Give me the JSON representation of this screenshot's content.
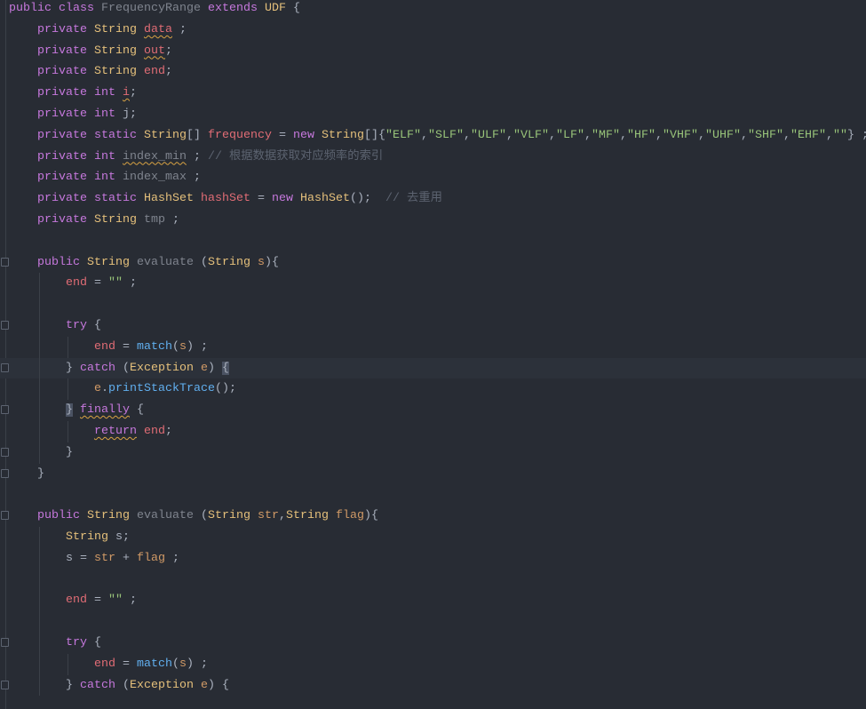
{
  "editor": {
    "colors": {
      "background": "#282c34",
      "keyword": "#c678dd",
      "type": "#e5c07b",
      "field": "#e06c75",
      "function": "#61afef",
      "param": "#d19a66",
      "string": "#98c379",
      "comment": "#5c6370"
    },
    "current_line": 18,
    "lines": [
      {
        "indent": 0,
        "fold": false,
        "tokens": [
          [
            "kw",
            "public class "
          ],
          [
            "nm",
            "FrequencyRange "
          ],
          [
            "kw",
            "extends "
          ],
          [
            "ty",
            "UDF "
          ],
          [
            "pl",
            "{"
          ]
        ]
      },
      {
        "indent": 1,
        "tokens": [
          [
            "kw",
            "private "
          ],
          [
            "ty",
            "String "
          ],
          [
            "fd warn",
            "data"
          ],
          [
            "pl",
            " ;"
          ]
        ]
      },
      {
        "indent": 1,
        "tokens": [
          [
            "kw",
            "private "
          ],
          [
            "ty",
            "String "
          ],
          [
            "fd warn",
            "out"
          ],
          [
            "pl",
            ";"
          ]
        ]
      },
      {
        "indent": 1,
        "tokens": [
          [
            "kw",
            "private "
          ],
          [
            "ty",
            "String "
          ],
          [
            "fd",
            "end"
          ],
          [
            "pl",
            ";"
          ]
        ]
      },
      {
        "indent": 1,
        "tokens": [
          [
            "kw",
            "private int "
          ],
          [
            "fd warn",
            "i"
          ],
          [
            "pl",
            ";"
          ]
        ]
      },
      {
        "indent": 1,
        "tokens": [
          [
            "kw",
            "private int "
          ],
          [
            "pl",
            "j;"
          ]
        ]
      },
      {
        "indent": 1,
        "tokens": [
          [
            "kw",
            "private static "
          ],
          [
            "ty",
            "String"
          ],
          [
            "pl",
            "[] "
          ],
          [
            "fd",
            "frequency"
          ],
          [
            "pl",
            " = "
          ],
          [
            "kw",
            "new "
          ],
          [
            "ty",
            "String"
          ],
          [
            "pl",
            "[]{"
          ],
          [
            "st",
            "\"ELF\""
          ],
          [
            "pl",
            ","
          ],
          [
            "st",
            "\"SLF\""
          ],
          [
            "pl",
            ","
          ],
          [
            "st",
            "\"ULF\""
          ],
          [
            "pl",
            ","
          ],
          [
            "st",
            "\"VLF\""
          ],
          [
            "pl",
            ","
          ],
          [
            "st",
            "\"LF\""
          ],
          [
            "pl",
            ","
          ],
          [
            "st",
            "\"MF\""
          ],
          [
            "pl",
            ","
          ],
          [
            "st",
            "\"HF\""
          ],
          [
            "pl",
            ","
          ],
          [
            "st",
            "\"VHF\""
          ],
          [
            "pl",
            ","
          ],
          [
            "st",
            "\"UHF\""
          ],
          [
            "pl",
            ","
          ],
          [
            "st",
            "\"SHF\""
          ],
          [
            "pl",
            ","
          ],
          [
            "st",
            "\"EHF\""
          ],
          [
            "pl",
            ","
          ],
          [
            "st",
            "\"\""
          ],
          [
            "pl",
            "} ;"
          ]
        ]
      },
      {
        "indent": 1,
        "tokens": [
          [
            "kw",
            "private int "
          ],
          [
            "nm warn",
            "index_min"
          ],
          [
            "pl",
            " ; "
          ],
          [
            "cm",
            "// 根据数据获取对应频率的索引"
          ]
        ]
      },
      {
        "indent": 1,
        "tokens": [
          [
            "kw",
            "private int "
          ],
          [
            "nm",
            "index_max"
          ],
          [
            "pl",
            " ;"
          ]
        ]
      },
      {
        "indent": 1,
        "tokens": [
          [
            "kw",
            "private static "
          ],
          [
            "ty",
            "HashSet "
          ],
          [
            "fd",
            "hashSet"
          ],
          [
            "pl",
            " = "
          ],
          [
            "kw",
            "new "
          ],
          [
            "ty",
            "HashSet"
          ],
          [
            "pl",
            "();  "
          ],
          [
            "cm",
            "// 去重用"
          ]
        ]
      },
      {
        "indent": 1,
        "tokens": [
          [
            "kw",
            "private "
          ],
          [
            "ty",
            "String "
          ],
          [
            "nm",
            "tmp"
          ],
          [
            "pl",
            " ;"
          ]
        ]
      },
      {
        "indent": 0,
        "tokens": []
      },
      {
        "indent": 1,
        "fold": true,
        "tokens": [
          [
            "kw",
            "public "
          ],
          [
            "ty",
            "String "
          ],
          [
            "nm",
            "evaluate "
          ],
          [
            "pl",
            "("
          ],
          [
            "ty",
            "String "
          ],
          [
            "pa",
            "s"
          ],
          [
            "pl",
            "){"
          ]
        ]
      },
      {
        "indent": 2,
        "tokens": [
          [
            "fd",
            "end"
          ],
          [
            "pl",
            " = "
          ],
          [
            "st",
            "\"\""
          ],
          [
            "pl",
            " ;"
          ]
        ]
      },
      {
        "indent": 2,
        "tokens": []
      },
      {
        "indent": 2,
        "fold": true,
        "tokens": [
          [
            "kw",
            "try "
          ],
          [
            "pl",
            "{"
          ]
        ]
      },
      {
        "indent": 3,
        "tokens": [
          [
            "fd",
            "end"
          ],
          [
            "pl",
            " = "
          ],
          [
            "fn",
            "match"
          ],
          [
            "pl",
            "("
          ],
          [
            "pa",
            "s"
          ],
          [
            "pl",
            ") ;"
          ]
        ]
      },
      {
        "indent": 2,
        "fold": true,
        "tokens": [
          [
            "pl",
            "} "
          ],
          [
            "kw",
            "catch "
          ],
          [
            "pl",
            "("
          ],
          [
            "ty",
            "Exception "
          ],
          [
            "pa",
            "e"
          ],
          [
            "pl",
            ") "
          ],
          [
            "pl brace",
            "{"
          ]
        ]
      },
      {
        "indent": 3,
        "tokens": [
          [
            "pa",
            "e"
          ],
          [
            "pl",
            "."
          ],
          [
            "fn",
            "printStackTrace"
          ],
          [
            "pl",
            "();"
          ]
        ]
      },
      {
        "indent": 2,
        "fold": true,
        "tokens": [
          [
            "pl brace",
            "}"
          ],
          [
            "pl",
            " "
          ],
          [
            "kw warn",
            "finally"
          ],
          [
            "pl",
            " {"
          ]
        ]
      },
      {
        "indent": 3,
        "tokens": [
          [
            "kw warn",
            "return"
          ],
          [
            "pl",
            " "
          ],
          [
            "fd",
            "end"
          ],
          [
            "pl",
            ";"
          ]
        ]
      },
      {
        "indent": 2,
        "fold": true,
        "tokens": [
          [
            "pl",
            "}"
          ]
        ]
      },
      {
        "indent": 1,
        "fold": true,
        "tokens": [
          [
            "pl",
            "}"
          ]
        ]
      },
      {
        "indent": 0,
        "tokens": []
      },
      {
        "indent": 1,
        "fold": true,
        "tokens": [
          [
            "kw",
            "public "
          ],
          [
            "ty",
            "String "
          ],
          [
            "nm",
            "evaluate "
          ],
          [
            "pl",
            "("
          ],
          [
            "ty",
            "String "
          ],
          [
            "pa",
            "str"
          ],
          [
            "pl",
            ","
          ],
          [
            "ty",
            "String "
          ],
          [
            "pa",
            "flag"
          ],
          [
            "pl",
            "){"
          ]
        ]
      },
      {
        "indent": 2,
        "tokens": [
          [
            "ty",
            "String "
          ],
          [
            "pl",
            "s;"
          ]
        ]
      },
      {
        "indent": 2,
        "tokens": [
          [
            "pl",
            "s = "
          ],
          [
            "pa",
            "str"
          ],
          [
            "pl",
            " + "
          ],
          [
            "pa",
            "flag"
          ],
          [
            "pl",
            " ;"
          ]
        ]
      },
      {
        "indent": 2,
        "tokens": []
      },
      {
        "indent": 2,
        "tokens": [
          [
            "fd",
            "end"
          ],
          [
            "pl",
            " = "
          ],
          [
            "st",
            "\"\""
          ],
          [
            "pl",
            " ;"
          ]
        ]
      },
      {
        "indent": 2,
        "tokens": []
      },
      {
        "indent": 2,
        "fold": true,
        "tokens": [
          [
            "kw",
            "try "
          ],
          [
            "pl",
            "{"
          ]
        ]
      },
      {
        "indent": 3,
        "tokens": [
          [
            "fd",
            "end"
          ],
          [
            "pl",
            " = "
          ],
          [
            "fn",
            "match"
          ],
          [
            "pl",
            "("
          ],
          [
            "pa",
            "s"
          ],
          [
            "pl",
            ") ;"
          ]
        ]
      },
      {
        "indent": 2,
        "fold": true,
        "tokens": [
          [
            "pl",
            "} "
          ],
          [
            "kw",
            "catch "
          ],
          [
            "pl",
            "("
          ],
          [
            "ty",
            "Exception "
          ],
          [
            "pa",
            "e"
          ],
          [
            "pl",
            ") {"
          ]
        ]
      }
    ]
  }
}
